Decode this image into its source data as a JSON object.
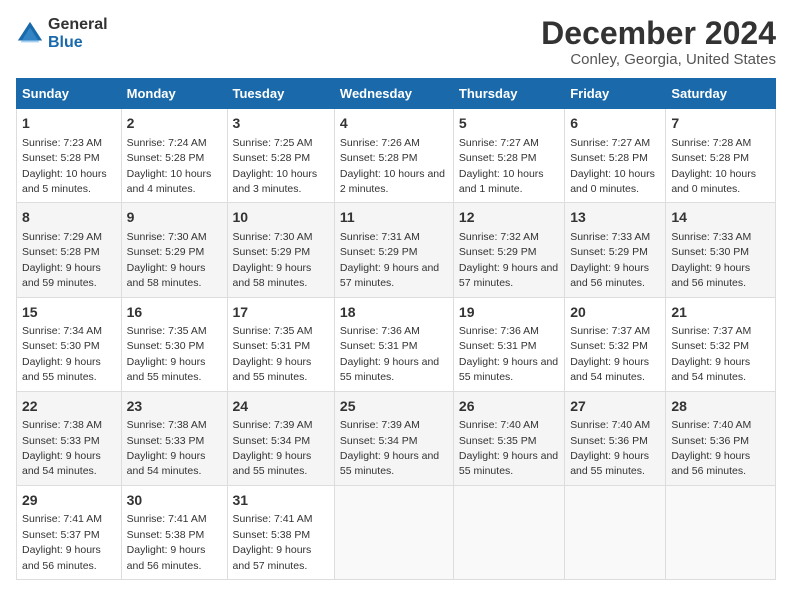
{
  "header": {
    "logo_line1": "General",
    "logo_line2": "Blue",
    "title": "December 2024",
    "subtitle": "Conley, Georgia, United States"
  },
  "days_of_week": [
    "Sunday",
    "Monday",
    "Tuesday",
    "Wednesday",
    "Thursday",
    "Friday",
    "Saturday"
  ],
  "weeks": [
    [
      {
        "day": "1",
        "sunrise": "7:23 AM",
        "sunset": "5:28 PM",
        "daylight": "10 hours and 5 minutes."
      },
      {
        "day": "2",
        "sunrise": "7:24 AM",
        "sunset": "5:28 PM",
        "daylight": "10 hours and 4 minutes."
      },
      {
        "day": "3",
        "sunrise": "7:25 AM",
        "sunset": "5:28 PM",
        "daylight": "10 hours and 3 minutes."
      },
      {
        "day": "4",
        "sunrise": "7:26 AM",
        "sunset": "5:28 PM",
        "daylight": "10 hours and 2 minutes."
      },
      {
        "day": "5",
        "sunrise": "7:27 AM",
        "sunset": "5:28 PM",
        "daylight": "10 hours and 1 minute."
      },
      {
        "day": "6",
        "sunrise": "7:27 AM",
        "sunset": "5:28 PM",
        "daylight": "10 hours and 0 minutes."
      },
      {
        "day": "7",
        "sunrise": "7:28 AM",
        "sunset": "5:28 PM",
        "daylight": "10 hours and 0 minutes."
      }
    ],
    [
      {
        "day": "8",
        "sunrise": "7:29 AM",
        "sunset": "5:28 PM",
        "daylight": "9 hours and 59 minutes."
      },
      {
        "day": "9",
        "sunrise": "7:30 AM",
        "sunset": "5:29 PM",
        "daylight": "9 hours and 58 minutes."
      },
      {
        "day": "10",
        "sunrise": "7:30 AM",
        "sunset": "5:29 PM",
        "daylight": "9 hours and 58 minutes."
      },
      {
        "day": "11",
        "sunrise": "7:31 AM",
        "sunset": "5:29 PM",
        "daylight": "9 hours and 57 minutes."
      },
      {
        "day": "12",
        "sunrise": "7:32 AM",
        "sunset": "5:29 PM",
        "daylight": "9 hours and 57 minutes."
      },
      {
        "day": "13",
        "sunrise": "7:33 AM",
        "sunset": "5:29 PM",
        "daylight": "9 hours and 56 minutes."
      },
      {
        "day": "14",
        "sunrise": "7:33 AM",
        "sunset": "5:30 PM",
        "daylight": "9 hours and 56 minutes."
      }
    ],
    [
      {
        "day": "15",
        "sunrise": "7:34 AM",
        "sunset": "5:30 PM",
        "daylight": "9 hours and 55 minutes."
      },
      {
        "day": "16",
        "sunrise": "7:35 AM",
        "sunset": "5:30 PM",
        "daylight": "9 hours and 55 minutes."
      },
      {
        "day": "17",
        "sunrise": "7:35 AM",
        "sunset": "5:31 PM",
        "daylight": "9 hours and 55 minutes."
      },
      {
        "day": "18",
        "sunrise": "7:36 AM",
        "sunset": "5:31 PM",
        "daylight": "9 hours and 55 minutes."
      },
      {
        "day": "19",
        "sunrise": "7:36 AM",
        "sunset": "5:31 PM",
        "daylight": "9 hours and 55 minutes."
      },
      {
        "day": "20",
        "sunrise": "7:37 AM",
        "sunset": "5:32 PM",
        "daylight": "9 hours and 54 minutes."
      },
      {
        "day": "21",
        "sunrise": "7:37 AM",
        "sunset": "5:32 PM",
        "daylight": "9 hours and 54 minutes."
      }
    ],
    [
      {
        "day": "22",
        "sunrise": "7:38 AM",
        "sunset": "5:33 PM",
        "daylight": "9 hours and 54 minutes."
      },
      {
        "day": "23",
        "sunrise": "7:38 AM",
        "sunset": "5:33 PM",
        "daylight": "9 hours and 54 minutes."
      },
      {
        "day": "24",
        "sunrise": "7:39 AM",
        "sunset": "5:34 PM",
        "daylight": "9 hours and 55 minutes."
      },
      {
        "day": "25",
        "sunrise": "7:39 AM",
        "sunset": "5:34 PM",
        "daylight": "9 hours and 55 minutes."
      },
      {
        "day": "26",
        "sunrise": "7:40 AM",
        "sunset": "5:35 PM",
        "daylight": "9 hours and 55 minutes."
      },
      {
        "day": "27",
        "sunrise": "7:40 AM",
        "sunset": "5:36 PM",
        "daylight": "9 hours and 55 minutes."
      },
      {
        "day": "28",
        "sunrise": "7:40 AM",
        "sunset": "5:36 PM",
        "daylight": "9 hours and 56 minutes."
      }
    ],
    [
      {
        "day": "29",
        "sunrise": "7:41 AM",
        "sunset": "5:37 PM",
        "daylight": "9 hours and 56 minutes."
      },
      {
        "day": "30",
        "sunrise": "7:41 AM",
        "sunset": "5:38 PM",
        "daylight": "9 hours and 56 minutes."
      },
      {
        "day": "31",
        "sunrise": "7:41 AM",
        "sunset": "5:38 PM",
        "daylight": "9 hours and 57 minutes."
      },
      null,
      null,
      null,
      null
    ]
  ]
}
